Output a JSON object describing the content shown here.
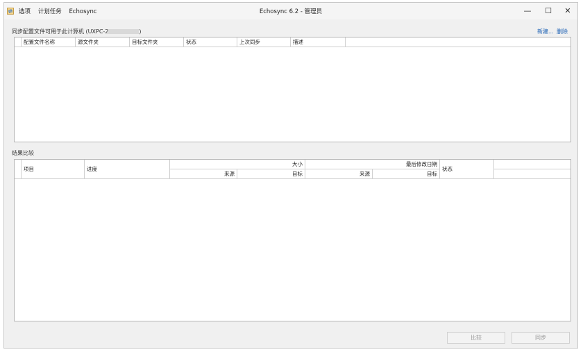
{
  "window": {
    "title": "Echosync 6.2 - 管理员",
    "menu": [
      "选项",
      "计划任务",
      "Echosync"
    ],
    "controls": {
      "minimize": "—",
      "maximize": "☐",
      "close": "✕"
    }
  },
  "profiles": {
    "label_prefix": "同步配置文件可用于此计算机 (UXPC-2",
    "label_suffix": ")",
    "new_link": "新建...",
    "delete_link": "删除",
    "columns": [
      "配置文件名称",
      "源文件夹",
      "目标文件夹",
      "状态",
      "上次同步",
      "描述"
    ]
  },
  "results": {
    "label": "结果比较",
    "item": "项目",
    "progress": "进度",
    "size": "大小",
    "modified": "最后修改日期",
    "source": "来源",
    "target": "目标",
    "status": "状态"
  },
  "buttons": {
    "compare": "比较",
    "sync": "同步"
  }
}
